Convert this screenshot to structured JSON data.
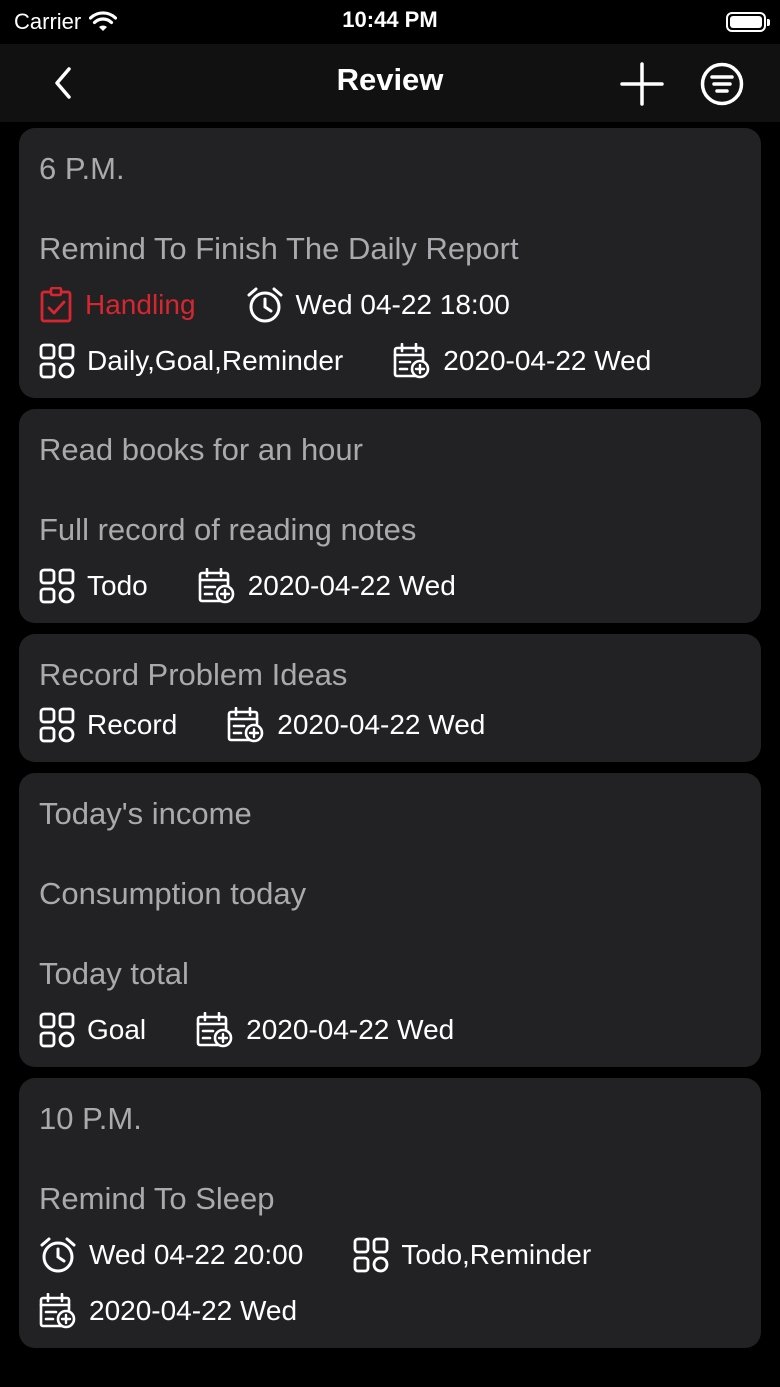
{
  "status_bar": {
    "carrier": "Carrier",
    "time": "10:44 PM"
  },
  "nav": {
    "title": "Review"
  },
  "colors": {
    "background": "#000000",
    "card": "#222224",
    "card_text": "#a9a9ae",
    "handling": "#d7262f"
  },
  "cards": [
    {
      "lines": [
        "6 P.M.",
        "Remind To Finish The Daily Report"
      ],
      "status": "Handling",
      "alarm": "Wed 04-22 18:00",
      "tags": "Daily,Goal,Reminder",
      "date": "2020-04-22 Wed"
    },
    {
      "lines": [
        "Read books for an hour",
        "Full record of reading notes"
      ],
      "tags": "Todo",
      "date": "2020-04-22 Wed"
    },
    {
      "lines": [
        "Record Problem Ideas"
      ],
      "tags": "Record",
      "date": "2020-04-22 Wed"
    },
    {
      "lines": [
        "Today's income",
        "Consumption today",
        "Today total"
      ],
      "tags": "Goal",
      "date": "2020-04-22 Wed"
    },
    {
      "lines": [
        "10 P.M.",
        "Remind To Sleep"
      ],
      "alarm": "Wed 04-22 20:00",
      "tags": "Todo,Reminder",
      "date": "2020-04-22 Wed"
    }
  ]
}
